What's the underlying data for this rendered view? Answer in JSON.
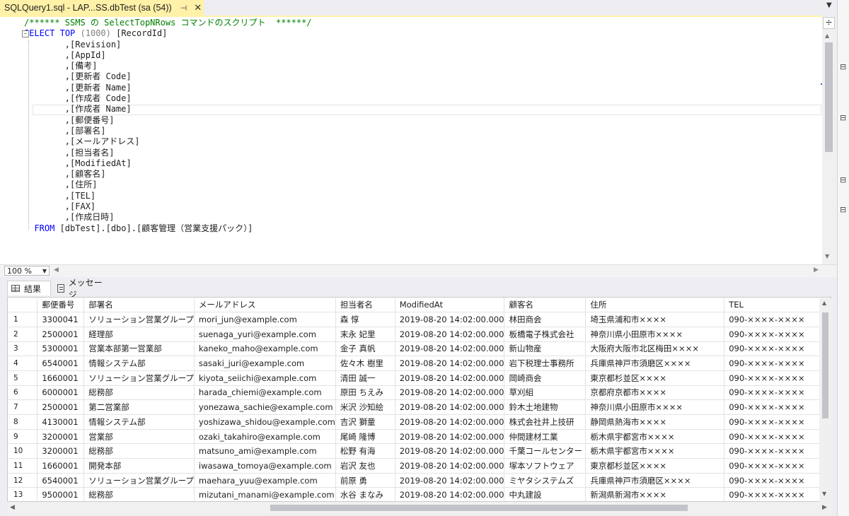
{
  "tab": {
    "title": "SQLQuery1.sql - LAP...SS.dbTest (sa (54))",
    "pin": "⊣",
    "close": "✕"
  },
  "editor": {
    "comment": "/****** SSMS の SelectTopNRows コマンドのスクリプト  ******/",
    "select_kw": "SELECT",
    "top_kw": "TOP",
    "top_value": "(1000)",
    "first_column": " [RecordId]",
    "columns": [
      ",[Revision]",
      ",[AppId]",
      ",[備考]",
      ",[更新者 Code]",
      ",[更新者 Name]",
      ",[作成者 Code]",
      ",[作成者 Name]",
      ",[郵便番号]",
      ",[部署名]",
      ",[メールアドレス]",
      ",[担当者名]",
      ",[ModifiedAt]",
      ",[顧客名]",
      ",[住所]",
      ",[TEL]",
      ",[FAX]",
      ",[作成日時]"
    ],
    "from_kw": "FROM",
    "from_table": " [dbTest].[dbo].[顧客管理（営業支援パック）]"
  },
  "zoom": {
    "value": "100 %"
  },
  "results_tabs": {
    "results": "結果",
    "messages": "メッセージ"
  },
  "grid": {
    "headers": [
      "",
      "郵便番号",
      "部署名",
      "メールアドレス",
      "担当者名",
      "ModifiedAt",
      "顧客名",
      "住所",
      "TEL"
    ],
    "rows": [
      [
        "1",
        "3300041",
        "ソリューション営業グループ",
        "mori_jun@example.com",
        "森 惇",
        "2019-08-20 14:02:00.000",
        "林田商会",
        "埼玉県浦和市××××",
        "090-××××-××××"
      ],
      [
        "2",
        "2500001",
        "経理部",
        "suenaga_yuri@example.com",
        "末永 妃里",
        "2019-08-20 14:02:00.000",
        "板橋電子株式会社",
        "神奈川県小田原市××××",
        "090-××××-××××"
      ],
      [
        "3",
        "5300001",
        "営業本部第一営業部",
        "kaneko_maho@example.com",
        "金子 真帆",
        "2019-08-20 14:02:00.000",
        "新山物産",
        "大阪府大阪市北区梅田××××",
        "090-××××-××××"
      ],
      [
        "4",
        "6540001",
        "情報システム部",
        "sasaki_juri@example.com",
        "佐々木 樹里",
        "2019-08-20 14:02:00.000",
        "岩下税理士事務所",
        "兵庫県神戸市須磨区××××",
        "090-××××-××××"
      ],
      [
        "5",
        "1660001",
        "ソリューション営業グループ",
        "kiyota_seiichi@example.com",
        "清田 誠一",
        "2019-08-20 14:02:00.000",
        "岡崎商会",
        "東京都杉並区××××",
        "090-××××-××××"
      ],
      [
        "6",
        "6000001",
        "総務部",
        "harada_chiemi@example.com",
        "原田 ちえみ",
        "2019-08-20 14:02:00.000",
        "草刈組",
        "京都府京都市××××",
        "090-××××-××××"
      ],
      [
        "7",
        "2500001",
        "第二営業部",
        "yonezawa_sachie@example.com",
        "米沢 沙知絵",
        "2019-08-20 14:02:00.000",
        "鈴木土地建物",
        "神奈川県小田原市××××",
        "090-××××-××××"
      ],
      [
        "8",
        "4130001",
        "情報システム部",
        "yoshizawa_shidou@example.com",
        "吉沢 獅童",
        "2019-08-20 14:02:00.000",
        "株式会社井上技研",
        "静岡県熱海市××××",
        "090-××××-××××"
      ],
      [
        "9",
        "3200001",
        "営業部",
        "ozaki_takahiro@example.com",
        "尾崎 隆博",
        "2019-08-20 14:02:00.000",
        "仲間建材工業",
        "栃木県宇都宮市××××",
        "090-××××-××××"
      ],
      [
        "10",
        "3200001",
        "総務部",
        "matsuno_ami@example.com",
        "松野 有海",
        "2019-08-20 14:02:00.000",
        "千葉コールセンター",
        "栃木県宇都宮市××××",
        "090-××××-××××"
      ],
      [
        "11",
        "1660001",
        "開発本部",
        "iwasawa_tomoya@example.com",
        "岩沢 友也",
        "2019-08-20 14:02:00.000",
        "塚本ソフトウェア",
        "東京都杉並区××××",
        "090-××××-××××"
      ],
      [
        "12",
        "6540001",
        "ソリューション営業グループ",
        "maehara_yuu@example.com",
        "前原 勇",
        "2019-08-20 14:02:00.000",
        "ミヤタシステムズ",
        "兵庫県神戸市須磨区××××",
        "090-××××-××××"
      ],
      [
        "13",
        "9500001",
        "総務部",
        "mizutani_manami@example.com",
        "水谷 まなみ",
        "2019-08-20 14:02:00.000",
        "中丸建設",
        "新潟県新潟市××××",
        "090-××××-××××"
      ]
    ]
  }
}
